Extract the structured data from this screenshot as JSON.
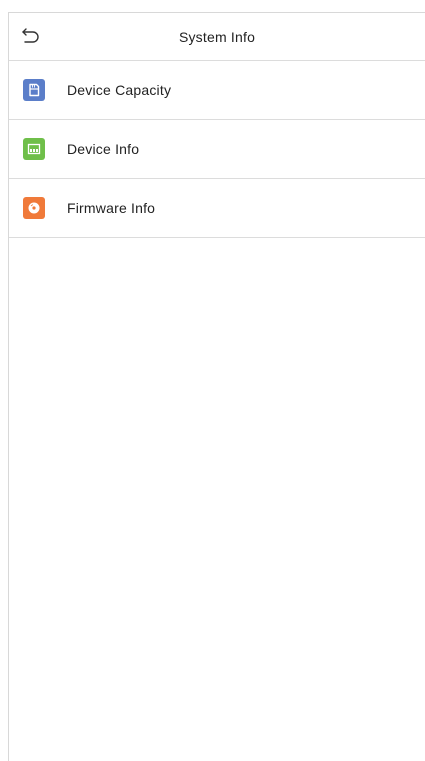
{
  "header": {
    "title": "System Info",
    "back_icon": "back-arrow-icon"
  },
  "menu": {
    "items": [
      {
        "label": "Device Capacity",
        "icon": "sd-card-icon",
        "color": "#5B7EC9"
      },
      {
        "label": "Device Info",
        "icon": "device-icon",
        "color": "#6FBF4A"
      },
      {
        "label": "Firmware Info",
        "icon": "disc-icon",
        "color": "#F07A3A"
      }
    ]
  }
}
